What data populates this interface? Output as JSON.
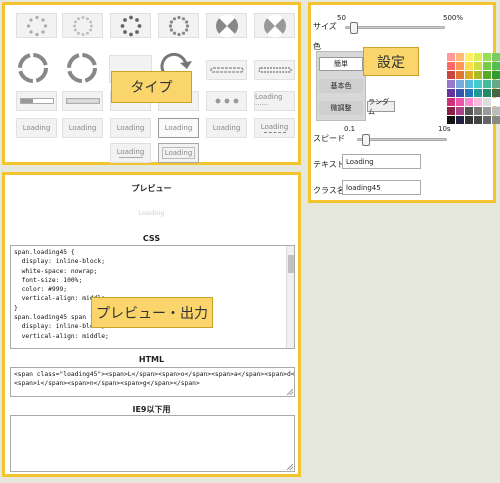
{
  "types": {
    "callout": "タイプ",
    "loading_text": "Loading",
    "loading_short": "Loading ······"
  },
  "settings": {
    "callout": "設定",
    "size": {
      "label": "サイズ",
      "min": "50",
      "max": "500%",
      "value_fraction": 0.07
    },
    "color": {
      "label": "色",
      "tabs": [
        "簡単",
        "基本色",
        "微調整"
      ],
      "random_button": "ランダム",
      "palette": [
        "#ff9999",
        "#ffbb77",
        "#ffee66",
        "#ddee55",
        "#99dd55",
        "#77cc66",
        "#ff6666",
        "#ff9955",
        "#ffdd44",
        "#cce044",
        "#77cc44",
        "#55bb55",
        "#cc4444",
        "#dd7733",
        "#ddaa22",
        "#aabb22",
        "#55aa22",
        "#339933",
        "#9977cc",
        "#77aadd",
        "#55bbdd",
        "#44cccc",
        "#44bb99",
        "#66aa88",
        "#663399",
        "#3355aa",
        "#2277bb",
        "#229999",
        "#228866",
        "#446644",
        "#cc3377",
        "#ee55aa",
        "#ff88cc",
        "#ffbbdd",
        "#dddddd",
        "#ffffff",
        "#882244",
        "#aa4488",
        "#555555",
        "#777777",
        "#999999",
        "#bbbbbb",
        "#111111",
        "#222244",
        "#333333",
        "#444444",
        "#666666",
        "#888888"
      ]
    },
    "speed": {
      "label": "スピード",
      "min": "0.1",
      "max": "10s",
      "value_fraction": 0.08
    },
    "text": {
      "label": "テキスト",
      "value": "Loading"
    },
    "classname": {
      "label": "クラス名",
      "value": "loading45"
    }
  },
  "output": {
    "callout": "プレビュー・出力",
    "preview_title": "プレビュー",
    "preview_text": "Loading",
    "css_title": "CSS",
    "css_code": "span.loading45 {\n  display: inline-block;\n  white-space: nowrap;\n  font-size: 100%;\n  color: #999;\n  vertical-align: middle;\n}\nspan.loading45 span {\n  display: inline-block;\n  vertical-align: middle;",
    "html_title": "HTML",
    "html_code": "<span class=\"loading45\"><span>L</span><span>o</span><span>a</span><span>d</span>\n<span>i</span><span>n</span><span>g</span></span>",
    "ie9_title": "IE9以下用",
    "ie9_code": ""
  },
  "colors": {
    "accent": "#f4c430",
    "callout": "#f9d56c"
  }
}
